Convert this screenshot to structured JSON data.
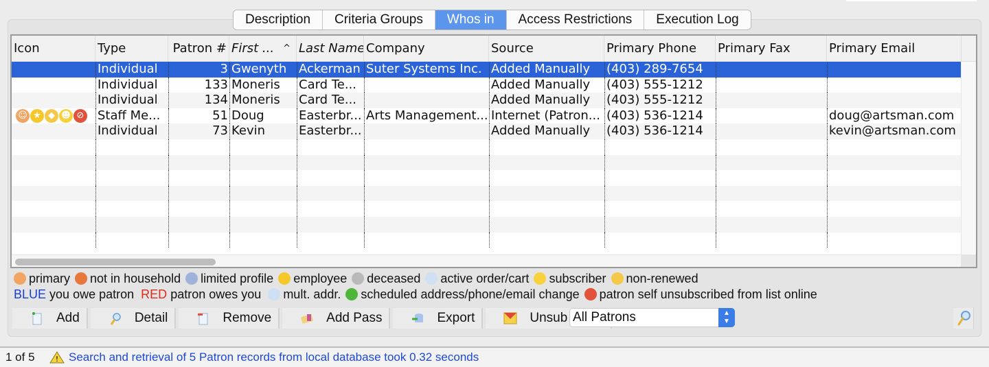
{
  "tabs": [
    {
      "label": "Description",
      "active": false
    },
    {
      "label": "Criteria Groups",
      "active": false
    },
    {
      "label": "Whos in",
      "active": true
    },
    {
      "label": "Access Restrictions",
      "active": false
    },
    {
      "label": "Execution Log",
      "active": false
    }
  ],
  "table": {
    "columns": [
      "Icon",
      "Type",
      "Patron #",
      "First ...",
      "Last Name¹",
      "Company",
      "Source",
      "Primary Phone",
      "Primary Fax",
      "Primary Email"
    ],
    "sort_indicator": "^",
    "rows": [
      {
        "icons": [],
        "type": "Individual",
        "patron": "3",
        "first": "Gwenyth",
        "last": "Ackerman",
        "company": "Suter Systems Inc.",
        "source": "Added Manually",
        "phone": "(403) 289-7654",
        "fax": "",
        "email": "",
        "selected": true
      },
      {
        "icons": [],
        "type": "Individual",
        "patron": "133",
        "first": "Moneris",
        "last": "Card Te...",
        "company": "",
        "source": "Added Manually",
        "phone": "(403) 555-1212",
        "fax": "",
        "email": "",
        "selected": false
      },
      {
        "icons": [],
        "type": "Individual",
        "patron": "134",
        "first": "Moneris",
        "last": "Card Te...",
        "company": "",
        "source": "Added Manually",
        "phone": "(403) 555-1212",
        "fax": "",
        "email": "",
        "selected": false
      },
      {
        "icons": [
          "primary-icon",
          "employee-icon",
          "non-renewed-icon",
          "subscriber-icon",
          "unsubscribed-icon"
        ],
        "type": "Staff Me...",
        "patron": "51",
        "first": "Doug",
        "last": "Easterbr...",
        "company": "Arts Management...",
        "source": "Internet (Patron...",
        "phone": "(403) 536-1214",
        "fax": "",
        "email": "doug@artsman.com",
        "selected": false
      },
      {
        "icons": [],
        "type": "Individual",
        "patron": "73",
        "first": "Kevin",
        "last": "Easterbr...",
        "company": "",
        "source": "Added Manually",
        "phone": "(403) 536-1214",
        "fax": "",
        "email": "kevin@artsman.com",
        "selected": false
      }
    ],
    "empty_rows": 7
  },
  "legend": {
    "line1": [
      {
        "icon": "primary-icon",
        "label": "primary",
        "color": "#f2a463"
      },
      {
        "icon": "not-in-household-icon",
        "label": "not in household",
        "color": "#e9763b"
      },
      {
        "icon": "limited-profile-icon",
        "label": "limited profile",
        "color": "#9fb2d9"
      },
      {
        "icon": "employee-icon",
        "label": "employee",
        "color": "#f5c72b"
      },
      {
        "icon": "deceased-icon",
        "label": "deceased",
        "color": "#b9b9b9"
      },
      {
        "icon": "active-order-cart-icon",
        "label": "active order/cart",
        "color": "#cfe0f4"
      },
      {
        "icon": "subscriber-icon",
        "label": "subscriber",
        "color": "#f7d23a"
      },
      {
        "icon": "non-renewed-icon",
        "label": "non-renewed",
        "color": "#f5c84a"
      }
    ],
    "line2": {
      "blue_word": "BLUE",
      "blue_text": "you owe patron",
      "red_word": "RED",
      "red_text": "patron owes you",
      "items": [
        {
          "icon": "multiple-address-icon",
          "label": "mult. addr.",
          "color": "#cfe0f4"
        },
        {
          "icon": "scheduled-change-icon",
          "label": "scheduled address/phone/email change",
          "color": "#4fb43a"
        },
        {
          "icon": "unsubscribed-icon",
          "label": "patron self unsubscribed from list online",
          "color": "#e2513a"
        }
      ]
    }
  },
  "toolbar": {
    "buttons": [
      {
        "name": "add-button",
        "icon": "add-document-icon",
        "label": "Add"
      },
      {
        "name": "detail-button",
        "icon": "magnifier-icon",
        "label": "Detail"
      },
      {
        "name": "remove-button",
        "icon": "remove-document-icon",
        "label": "Remove"
      },
      {
        "name": "add-pass-button",
        "icon": "pass-icon",
        "label": "Add Pass"
      },
      {
        "name": "export-button",
        "icon": "export-database-icon",
        "label": "Export"
      },
      {
        "name": "unsub-email-button",
        "icon": "envelope-icon",
        "label": "Unsub Email"
      }
    ],
    "filter_select": "All Patrons"
  },
  "status": {
    "count": "1 of 5",
    "message": "Search and retrieval of 5 Patron records from local database took 0.32 seconds"
  },
  "colors": {
    "selection": "#2a62d8",
    "active_tab": "#5b95ec",
    "status_text": "#1d48d8"
  }
}
